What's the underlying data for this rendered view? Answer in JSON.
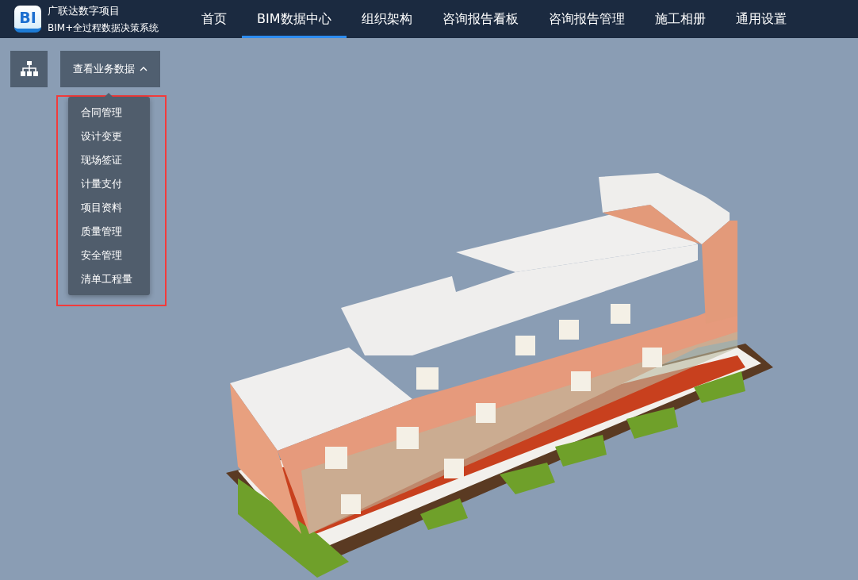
{
  "app": {
    "logo_text": "BI",
    "title": "广联达数字项目",
    "subtitle": "BIM+全过程数据决策系统"
  },
  "nav": [
    {
      "label": "首页",
      "selected": false
    },
    {
      "label": "BIM数据中心",
      "selected": true
    },
    {
      "label": "组织架构",
      "selected": false
    },
    {
      "label": "咨询报告看板",
      "selected": false
    },
    {
      "label": "咨询报告管理",
      "selected": false
    },
    {
      "label": "施工相册",
      "selected": false
    },
    {
      "label": "通用设置",
      "selected": false
    }
  ],
  "toolbar": {
    "dropdown": {
      "label": "查看业务数据",
      "expanded": true,
      "highlighted": true,
      "items": [
        "合同管理",
        "设计变更",
        "现场签证",
        "计量支付",
        "项目资料",
        "质量管理",
        "安全管理",
        "清单工程量"
      ]
    }
  }
}
